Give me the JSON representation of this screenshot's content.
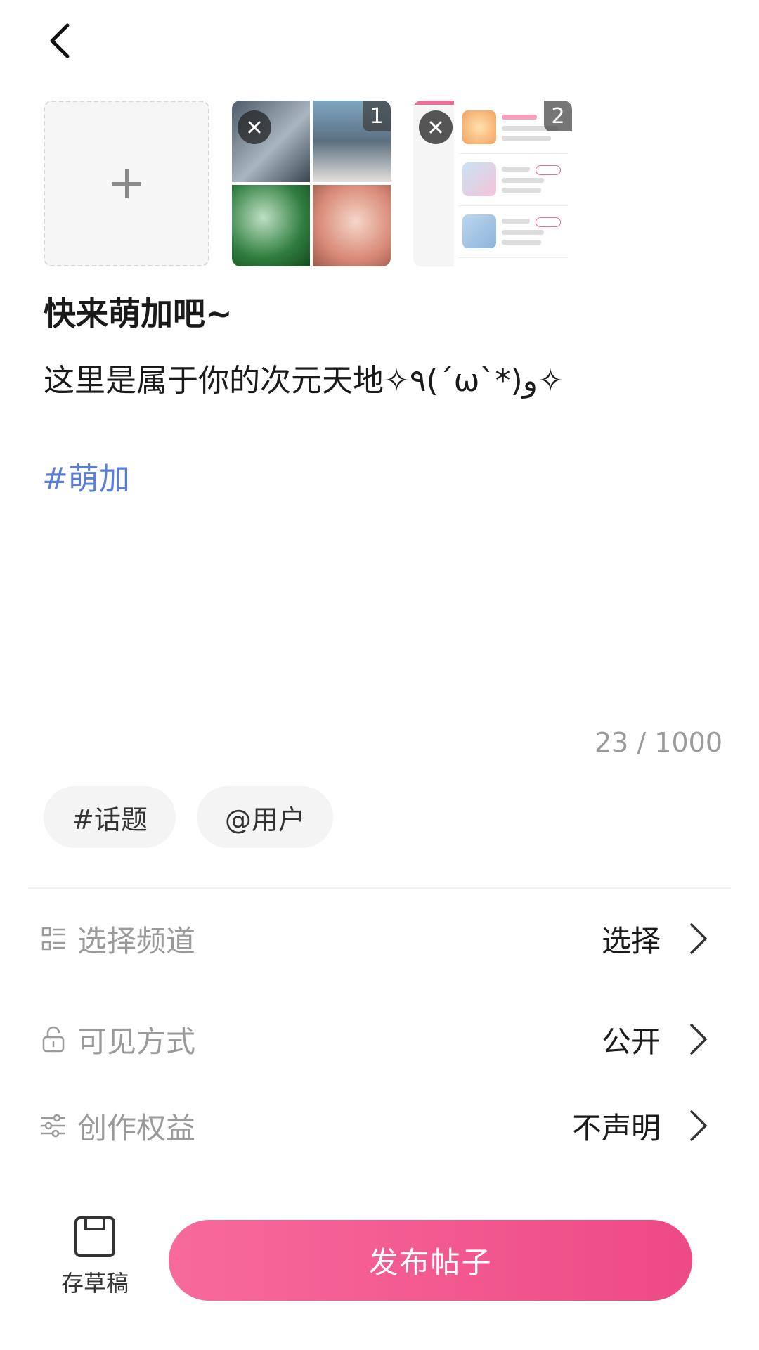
{
  "header": {
    "back_icon": "chevron-left-icon"
  },
  "images": {
    "add_icon": "plus-icon",
    "thumbs": [
      {
        "index": "1",
        "remove_icon": "close-icon"
      },
      {
        "index": "2",
        "remove_icon": "close-icon"
      }
    ]
  },
  "post": {
    "title": "快来萌加吧~",
    "body": "这里是属于你的次元天地✧٩(ˊωˋ*)و✧",
    "hashtag": "#萌加"
  },
  "counter": {
    "text": "23 / 1000"
  },
  "chips": {
    "topic": "#话题",
    "user": "@用户"
  },
  "options": {
    "channel": {
      "label": "选择频道",
      "value": "选择",
      "icon": "list-grid-icon"
    },
    "visibility": {
      "label": "可见方式",
      "value": "公开",
      "icon": "lock-icon"
    },
    "rights": {
      "label": "创作权益",
      "value": "不声明",
      "icon": "sliders-icon"
    }
  },
  "footer": {
    "draft_label": "存草稿",
    "draft_icon": "save-icon",
    "publish_label": "发布帖子"
  },
  "colors": {
    "accent_pink": "#ee4a85",
    "hashtag_blue": "#5b7ed6"
  }
}
